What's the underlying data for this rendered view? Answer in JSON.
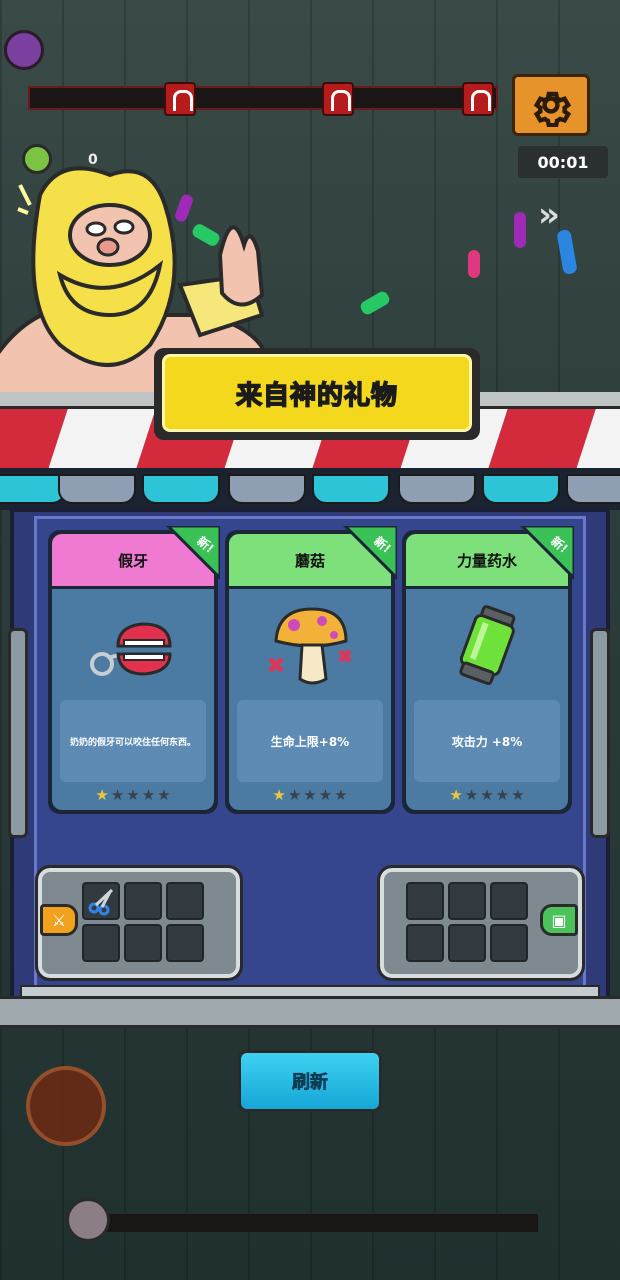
{
  "hud": {
    "coin_count": "0",
    "timer": "00:01",
    "progress_fraction": 0
  },
  "popup": {
    "title": "来自神的礼物",
    "new_badge": "新!",
    "cards": [
      {
        "name": "假牙",
        "desc": "奶奶的假牙可以咬住任何东西。",
        "stars_filled": 1,
        "stars_total": 5,
        "header_color": "#f07ad2",
        "icon": "false-teeth-icon"
      },
      {
        "name": "蘑菇",
        "desc": "生命上限+8%",
        "stars_filled": 1,
        "stars_total": 5,
        "header_color": "#7de07a",
        "icon": "mushroom-icon"
      },
      {
        "name": "力量药水",
        "desc": "攻击力 +8%",
        "stars_filled": 1,
        "stars_total": 5,
        "header_color": "#7de07a",
        "icon": "power-potion-icon"
      }
    ],
    "inventory_left": {
      "tag_icon": "attack-tag-icon",
      "filled_slots": 1,
      "slot_icon": "scissors-icon"
    },
    "inventory_right": {
      "tag_icon": "passive-tag-icon",
      "filled_slots": 0
    },
    "refresh_label": "刷新"
  },
  "colors": {
    "title_yellow": "#f4d81d",
    "panel_blue": "#35468e",
    "refresh_cyan": "#2dbfe6",
    "awning_red": "#d32a3c"
  }
}
